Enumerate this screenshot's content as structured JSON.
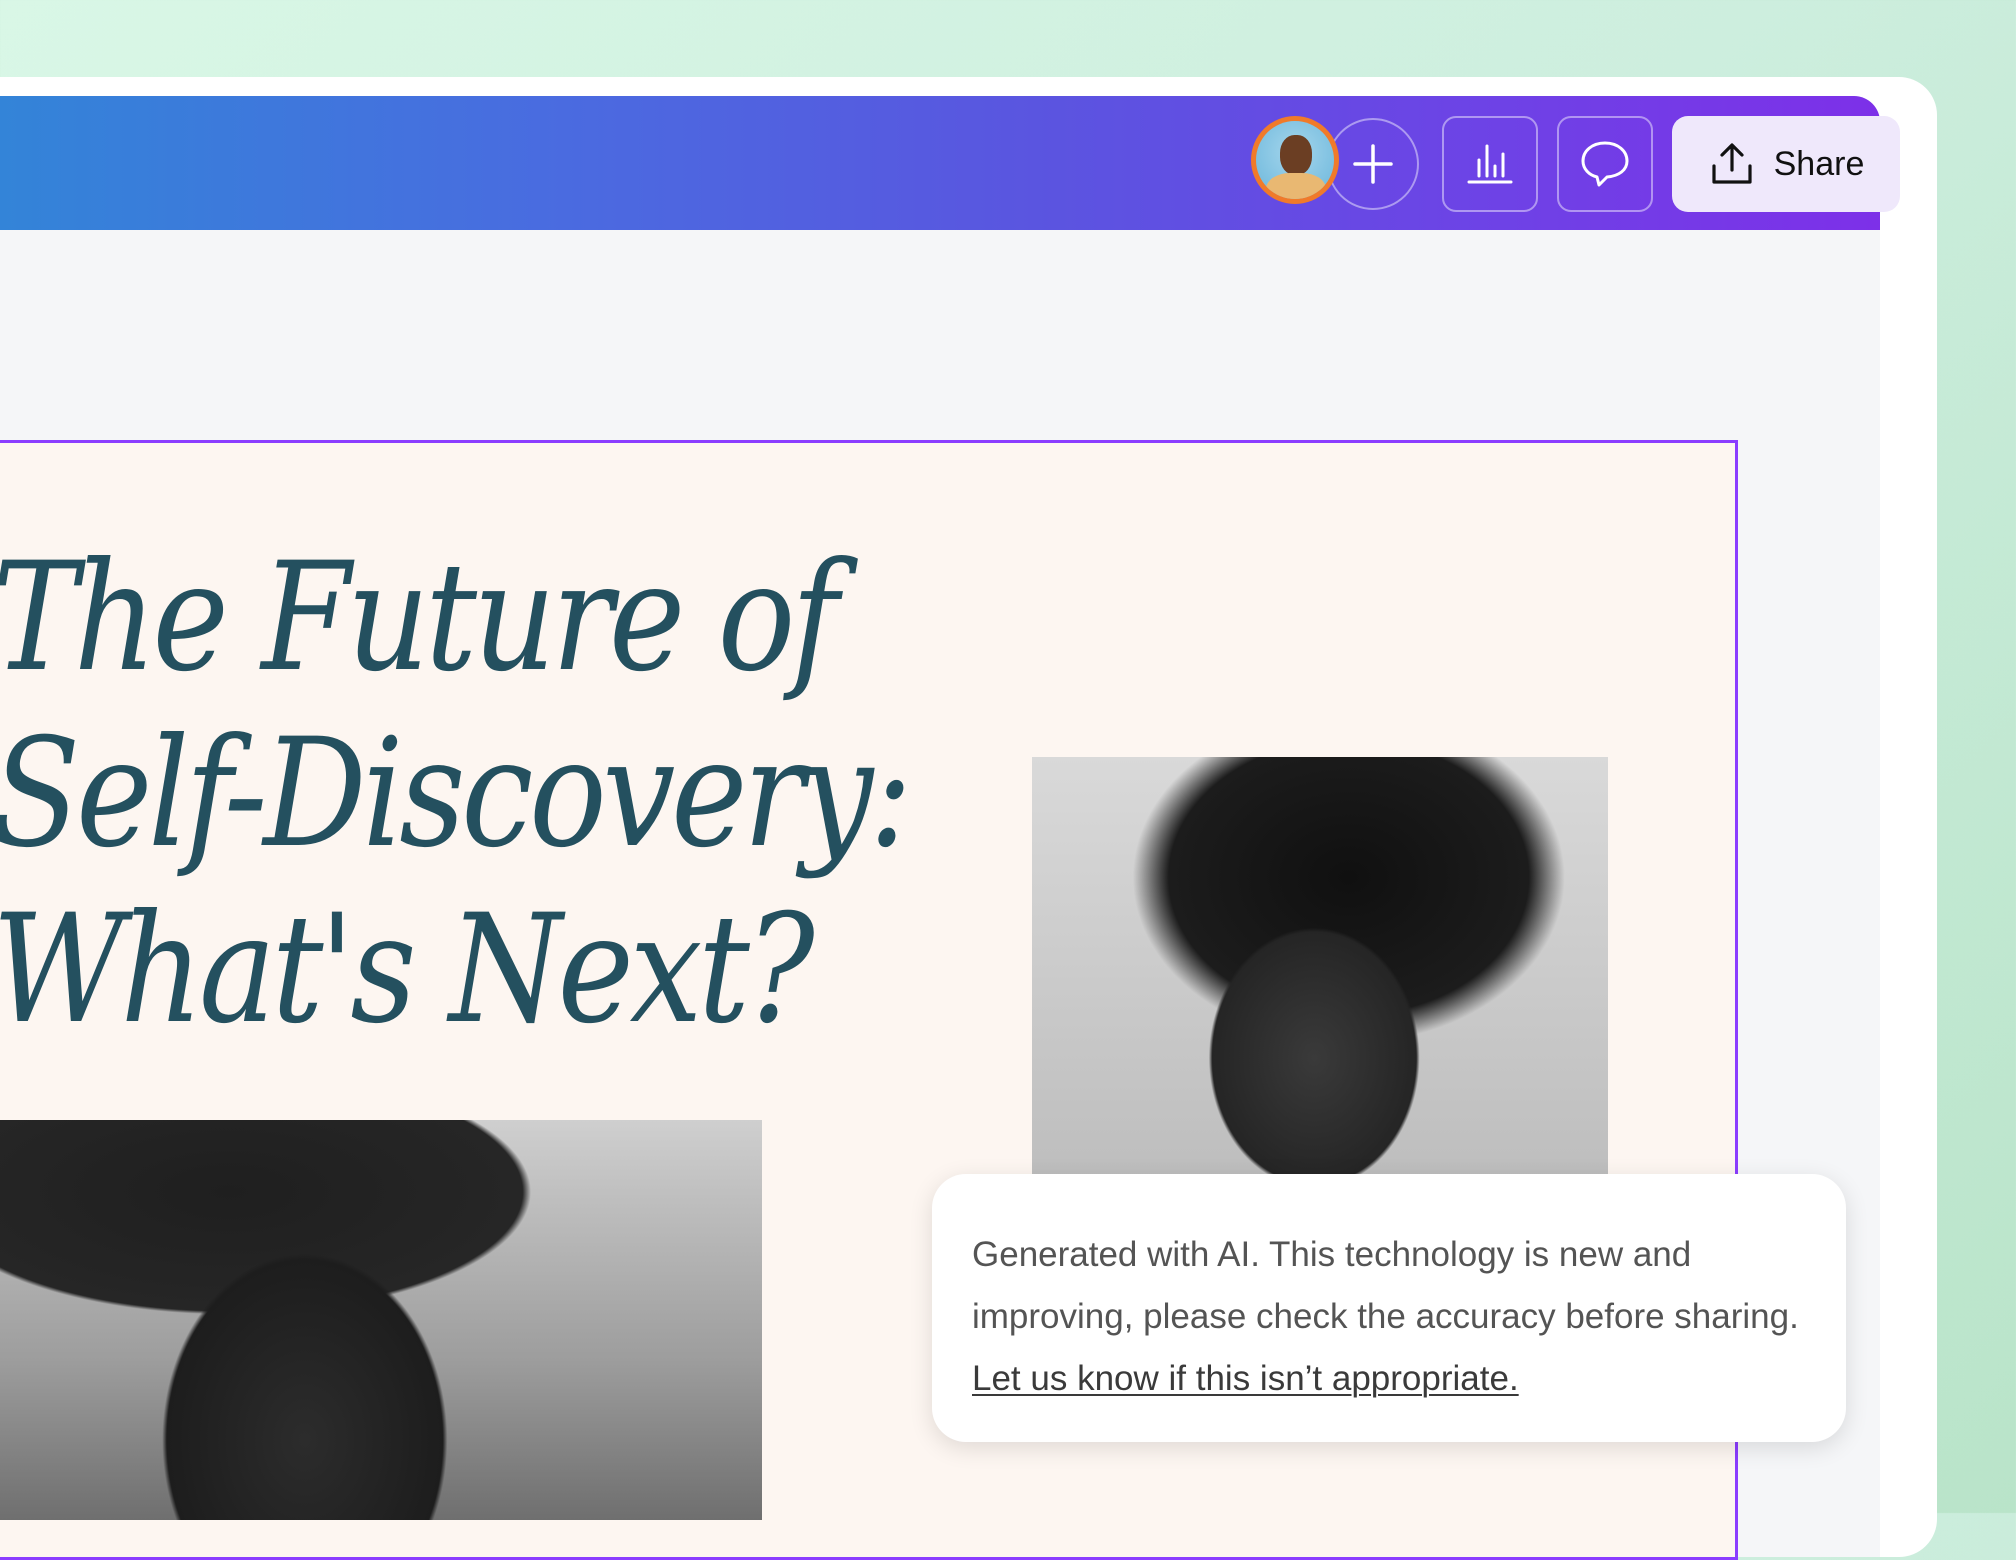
{
  "header": {
    "collaborator_avatar": "user-avatar",
    "add_icon": "plus-icon",
    "insights_icon": "bar-chart-icon",
    "comments_icon": "speech-bubble-icon",
    "share_icon": "upload-icon",
    "share_label": "Share"
  },
  "design": {
    "title": "The Future of\nSelf-Discovery:\nWhat's Next?",
    "images": [
      "woman-portrait-photo",
      "man-profile-photo"
    ]
  },
  "ai_notice": {
    "text": "Generated with AI. This technology is new and improving, please check the accuracy before sharing. ",
    "link_label": "Let us know if this isn’t appropriate."
  },
  "colors": {
    "accent_purple": "#8b3dff",
    "title_color": "#24505f",
    "page_background": "#fdf6f1"
  }
}
